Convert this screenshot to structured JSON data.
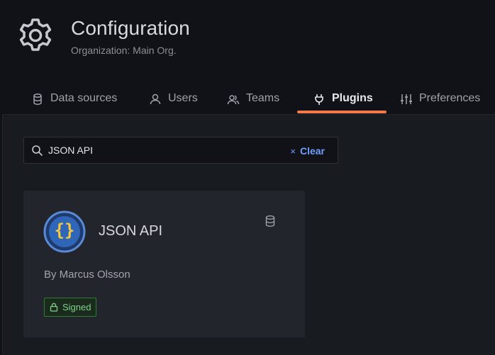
{
  "header": {
    "title": "Configuration",
    "subtitle": "Organization: Main Org."
  },
  "tabs": [
    {
      "label": "Data sources",
      "icon": "database-icon",
      "active": false
    },
    {
      "label": "Users",
      "icon": "user-icon",
      "active": false
    },
    {
      "label": "Teams",
      "icon": "users-icon",
      "active": false
    },
    {
      "label": "Plugins",
      "icon": "plug-icon",
      "active": true
    },
    {
      "label": "Preferences",
      "icon": "sliders-icon",
      "active": false
    }
  ],
  "search": {
    "value": "JSON API",
    "clear_label": "Clear",
    "clear_glyph": "×"
  },
  "plugin_card": {
    "name": "JSON API",
    "author": "By Marcus Olsson",
    "logo_text": "{}",
    "badge_label": "Signed",
    "type_icon": "database-icon"
  },
  "colors": {
    "accent": "#f57a4b",
    "link": "#6e9fff",
    "signed_green": "#7fd18a",
    "logo_ring": "#5a8ad6",
    "logo_braces": "#f5c842"
  }
}
